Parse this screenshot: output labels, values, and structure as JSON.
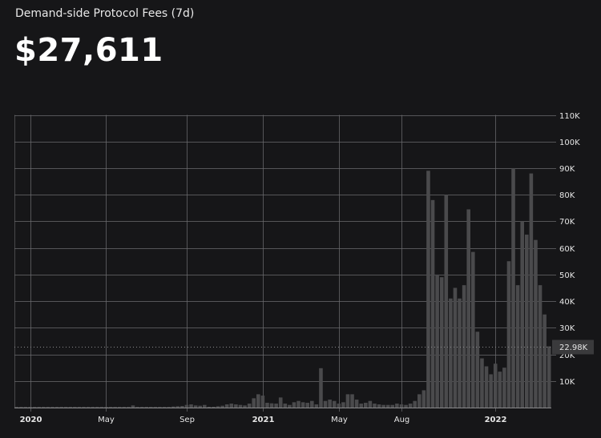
{
  "header": {
    "title": "Demand-side Protocol Fees (7d)",
    "value": "$27,611"
  },
  "colors": {
    "background": "#161618",
    "bar": "#4a4a4c",
    "grid": "#6b6b6e",
    "text": "#e6e6e6",
    "label_box": "#3a3a3c"
  },
  "chart_data": {
    "type": "bar",
    "title": "Demand-side Protocol Fees (7d)",
    "xlabel": "",
    "ylabel": "",
    "ylim": [
      0,
      110000
    ],
    "y_axis_side": "right",
    "grid": true,
    "y_ticks": [
      {
        "value": 10000,
        "label": "10K"
      },
      {
        "value": 20000,
        "label": "20K"
      },
      {
        "value": 30000,
        "label": "30K"
      },
      {
        "value": 40000,
        "label": "40K"
      },
      {
        "value": 50000,
        "label": "50K"
      },
      {
        "value": 60000,
        "label": "60K"
      },
      {
        "value": 70000,
        "label": "70K"
      },
      {
        "value": 80000,
        "label": "80K"
      },
      {
        "value": 90000,
        "label": "90K"
      },
      {
        "value": 100000,
        "label": "100K"
      },
      {
        "value": 110000,
        "label": "110K"
      }
    ],
    "x_ticks": [
      {
        "index": 3,
        "label": "2020",
        "bold": true
      },
      {
        "index": 20,
        "label": "May",
        "bold": false
      },
      {
        "index": 38,
        "label": "Sep",
        "bold": false
      },
      {
        "index": 55,
        "label": "2021",
        "bold": true
      },
      {
        "index": 72,
        "label": "May",
        "bold": false
      },
      {
        "index": 86,
        "label": "Aug",
        "bold": false
      },
      {
        "index": 107,
        "label": "2022",
        "bold": true
      }
    ],
    "last_value_label": "22.98K",
    "last_value": 22980,
    "values": [
      150,
      150,
      150,
      150,
      150,
      150,
      150,
      150,
      150,
      150,
      150,
      150,
      150,
      150,
      150,
      150,
      150,
      150,
      150,
      150,
      150,
      150,
      150,
      150,
      150,
      150,
      800,
      150,
      150,
      150,
      150,
      150,
      150,
      150,
      200,
      400,
      500,
      600,
      1000,
      1200,
      800,
      700,
      1000,
      300,
      300,
      500,
      700,
      1200,
      1500,
      1200,
      1000,
      800,
      1500,
      3500,
      5000,
      4500,
      1800,
      1600,
      1500,
      3800,
      1500,
      1000,
      2000,
      2500,
      2000,
      1800,
      2500,
      1200,
      14800,
      2500,
      3000,
      2500,
      1500,
      2000,
      5000,
      5000,
      3000,
      1500,
      1800,
      2500,
      1500,
      1200,
      1000,
      1000,
      1000,
      1500,
      1200,
      1000,
      1500,
      2500,
      5000,
      6500,
      89000,
      78000,
      50000,
      49000,
      80000,
      41000,
      45000,
      41000,
      46000,
      74500,
      58500,
      28500,
      18500,
      15500,
      12500,
      16500,
      13500,
      15000,
      55000,
      90000,
      46000,
      70000,
      65000,
      88000,
      63000,
      46000,
      35000,
      23000
    ]
  }
}
